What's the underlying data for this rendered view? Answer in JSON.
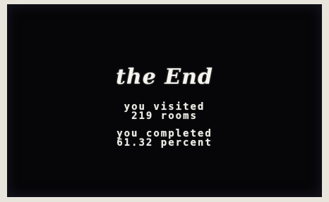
{
  "end_screen": {
    "title": "the End",
    "visited_label": "you visited",
    "visited_value": "219 rooms",
    "completed_label": "you completed",
    "completed_value": "61.32 percent"
  }
}
